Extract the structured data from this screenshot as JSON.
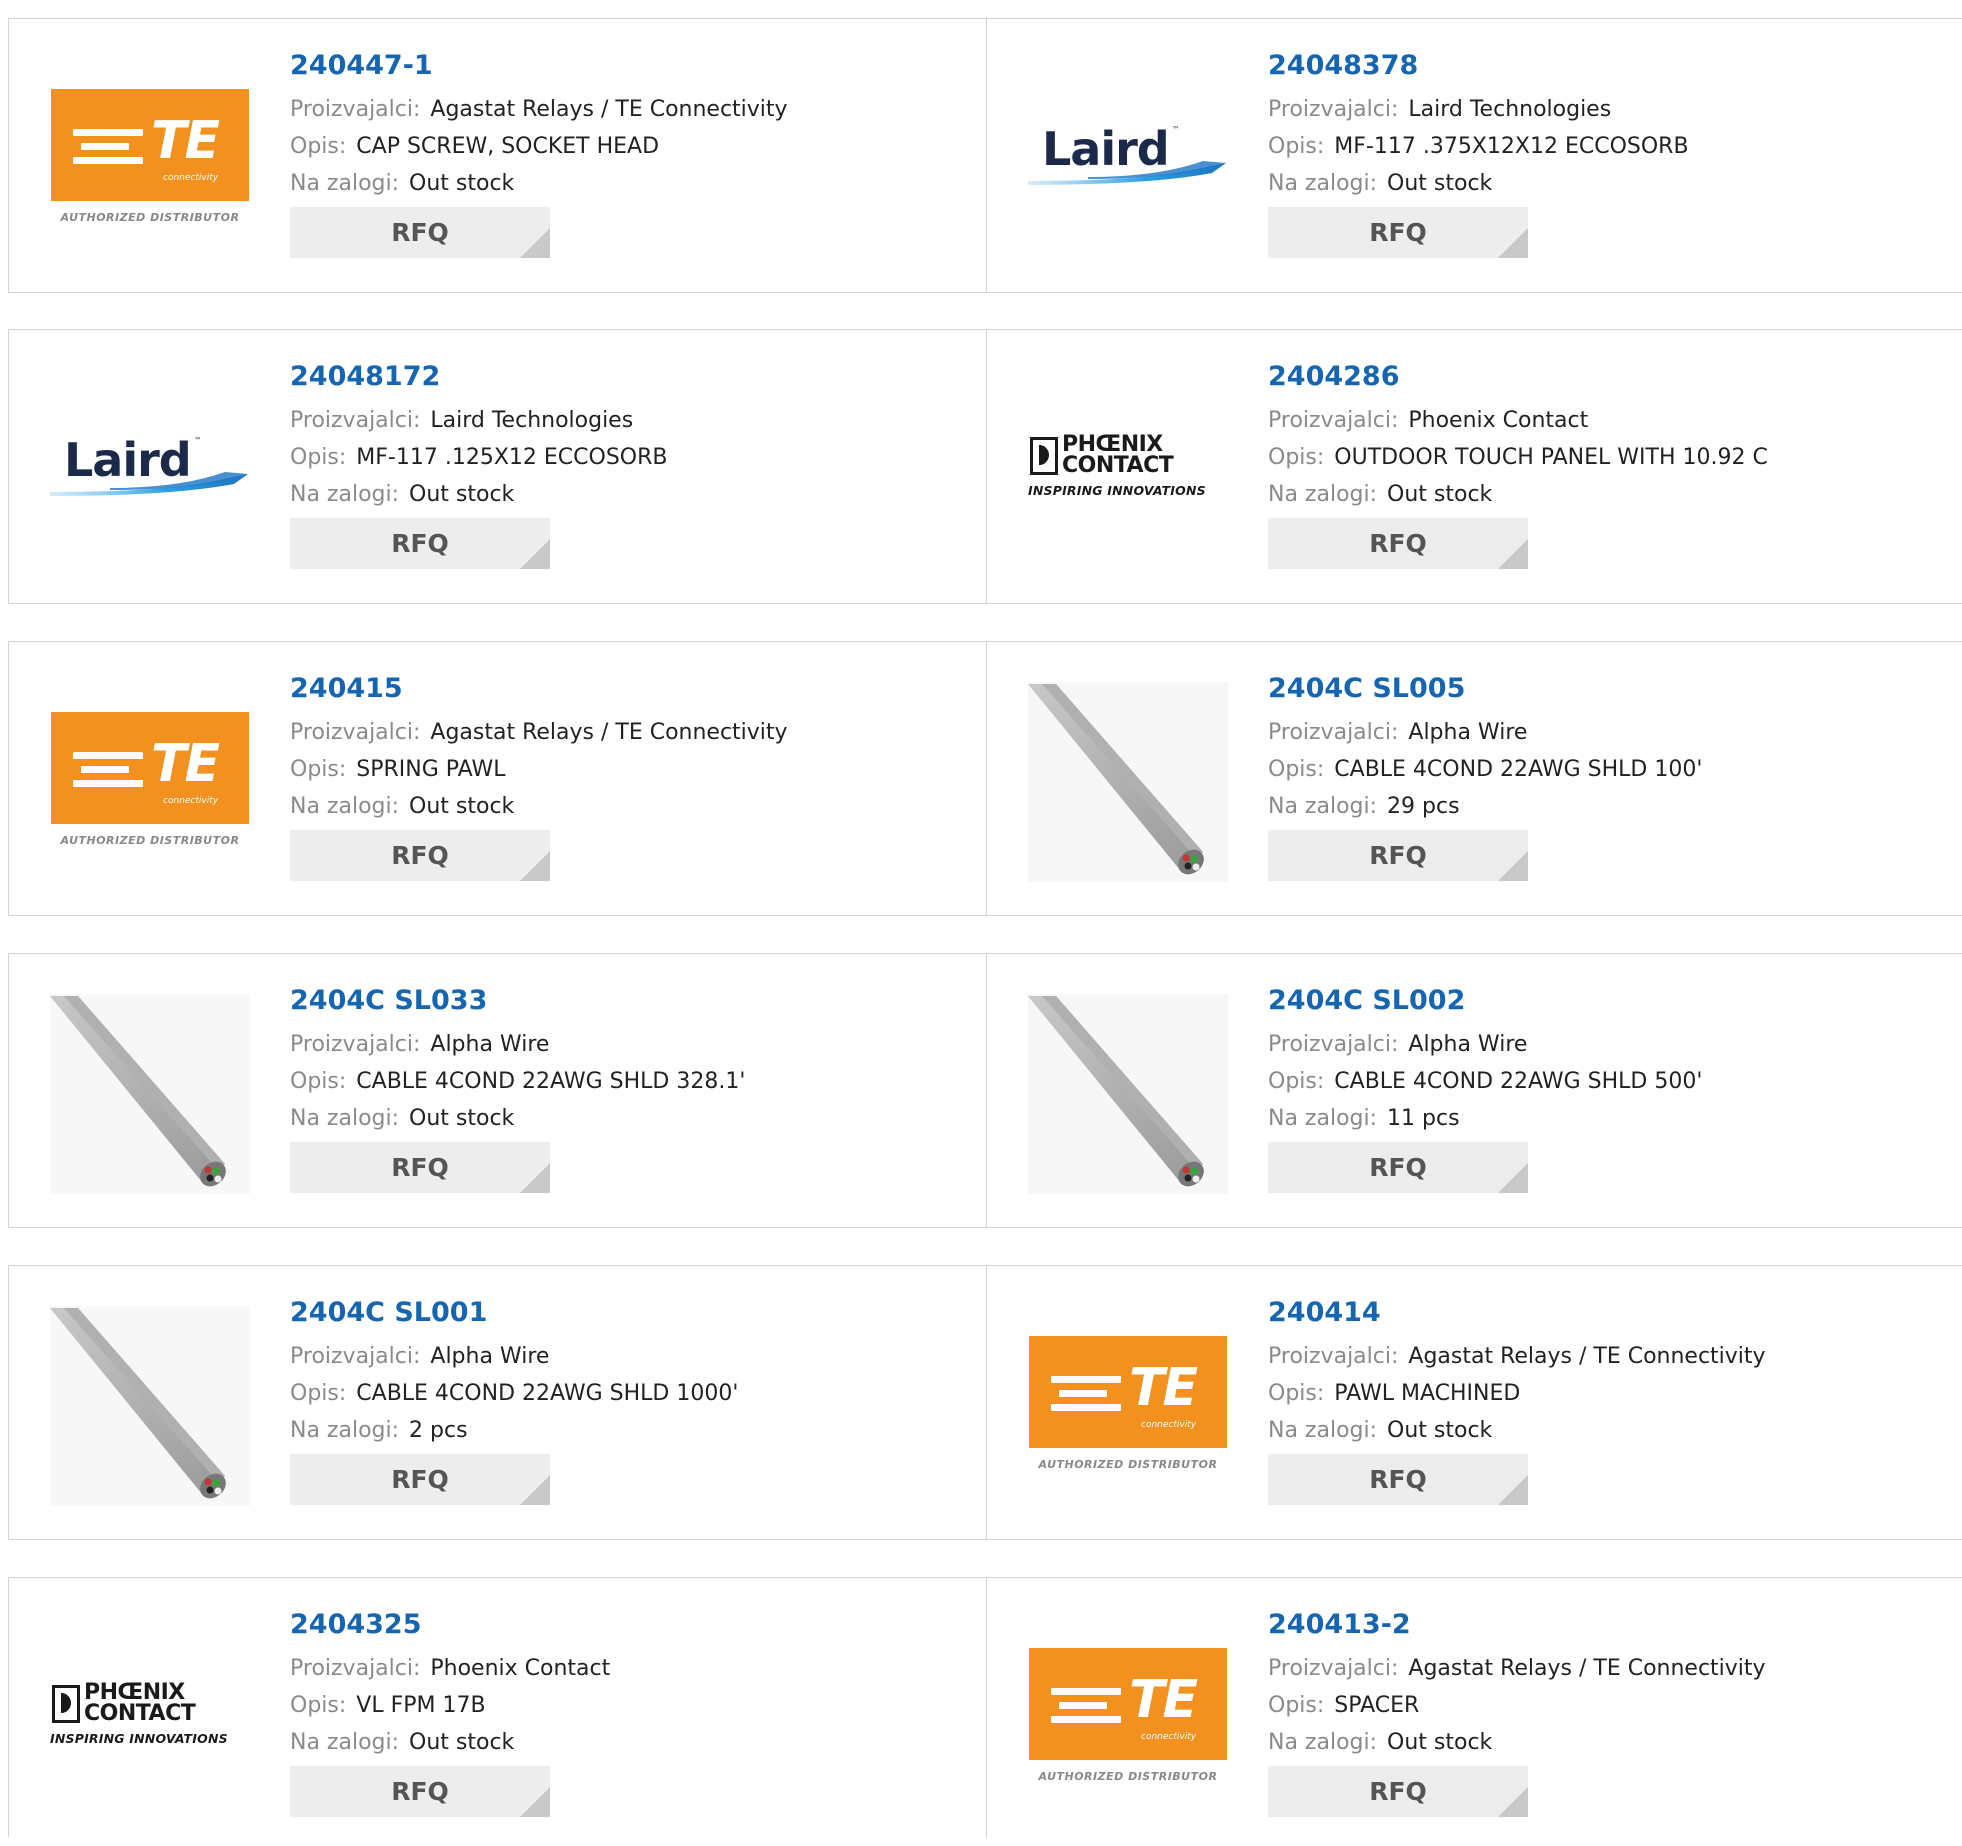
{
  "labels": {
    "manufacturer": "Proizvajalci:",
    "description": "Opis:",
    "stock": "Na zalogi:",
    "rfq": "RFQ"
  },
  "logo_text": {
    "te_word": "TE",
    "te_sub": "connectivity",
    "te_authorized": "AUTHORIZED DISTRIBUTOR",
    "laird": "Laird",
    "phoenix_line1": "PHŒNIX",
    "phoenix_line2": "CONTACT",
    "phoenix_tagline": "INSPIRING INNOVATIONS"
  },
  "colors": {
    "part_number": "#1565b0",
    "te_orange": "#f29120",
    "rfq_bg": "#ededed"
  },
  "products": [
    {
      "part": "240447-1",
      "logo": "te-logo",
      "manufacturer": "Agastat Relays / TE Connectivity",
      "description": "CAP SCREW, SOCKET HEAD",
      "stock": "Out stock"
    },
    {
      "part": "24048378",
      "logo": "laird-logo",
      "manufacturer": "Laird Technologies",
      "description": "MF-117 .375X12X12 ECCOSORB",
      "stock": "Out stock"
    },
    {
      "part": "24048172",
      "logo": "laird-logo",
      "manufacturer": "Laird Technologies",
      "description": "MF-117 .125X12 ECCOSORB",
      "stock": "Out stock"
    },
    {
      "part": "2404286",
      "logo": "phoenix-logo",
      "manufacturer": "Phoenix Contact",
      "description": "OUTDOOR TOUCH PANEL WITH 10.92 C",
      "stock": "Out stock"
    },
    {
      "part": "240415",
      "logo": "te-logo",
      "manufacturer": "Agastat Relays / TE Connectivity",
      "description": "SPRING PAWL",
      "stock": "Out stock"
    },
    {
      "part": "2404C SL005",
      "logo": "cable-image",
      "manufacturer": "Alpha Wire",
      "description": "CABLE 4COND 22AWG SHLD 100'",
      "stock": "29 pcs"
    },
    {
      "part": "2404C SL033",
      "logo": "cable-image",
      "manufacturer": "Alpha Wire",
      "description": "CABLE 4COND 22AWG SHLD 328.1'",
      "stock": "Out stock"
    },
    {
      "part": "2404C SL002",
      "logo": "cable-image",
      "manufacturer": "Alpha Wire",
      "description": "CABLE 4COND 22AWG SHLD 500'",
      "stock": "11 pcs"
    },
    {
      "part": "2404C SL001",
      "logo": "cable-image",
      "manufacturer": "Alpha Wire",
      "description": "CABLE 4COND 22AWG SHLD 1000'",
      "stock": "2 pcs"
    },
    {
      "part": "240414",
      "logo": "te-logo",
      "manufacturer": "Agastat Relays / TE Connectivity",
      "description": "PAWL MACHINED",
      "stock": "Out stock"
    },
    {
      "part": "2404325",
      "logo": "phoenix-logo",
      "manufacturer": "Phoenix Contact",
      "description": "VL FPM 17B",
      "stock": "Out stock"
    },
    {
      "part": "240413-2",
      "logo": "te-logo",
      "manufacturer": "Agastat Relays / TE Connectivity",
      "description": "SPACER",
      "stock": "Out stock"
    }
  ]
}
